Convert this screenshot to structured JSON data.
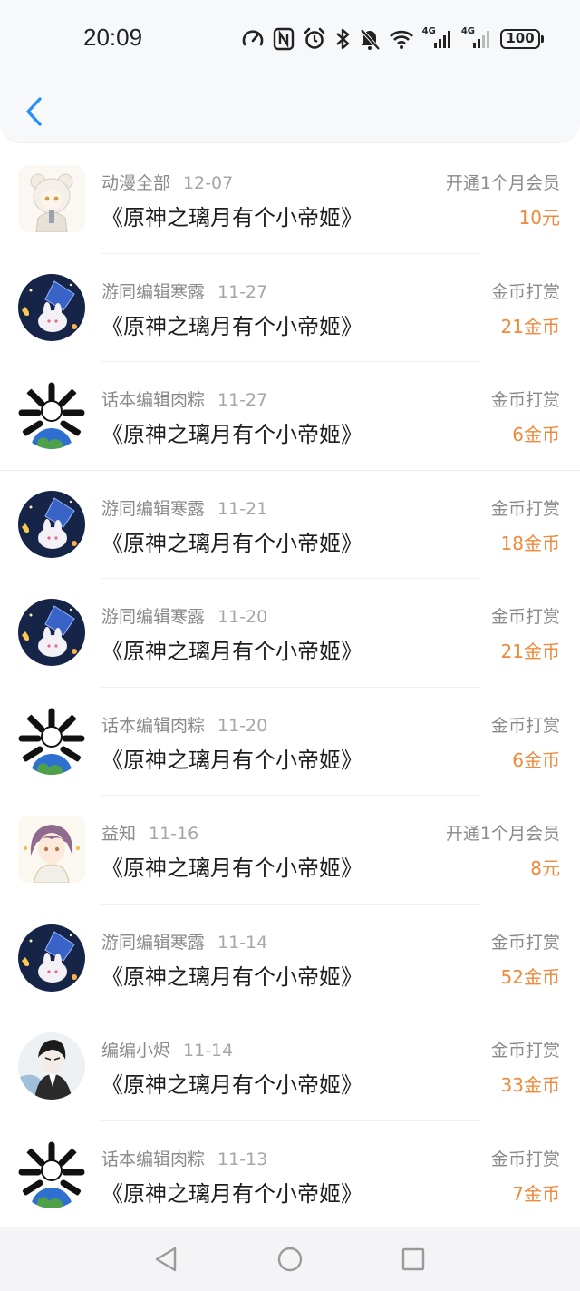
{
  "status_bar": {
    "time": "20:09",
    "net1": "4G",
    "net2": "4G",
    "battery": "100"
  },
  "colors": {
    "accent_blue": "#2a8ff7",
    "amount_orange": "#ef8a3c"
  },
  "records": [
    {
      "user": "动漫全部",
      "date": "12-07",
      "title": "《原神之璃月有个小帝姬》",
      "type": "开通1个月会员",
      "amount": "10元",
      "avatar": "anime-girl-white-hair"
    },
    {
      "user": "游同编辑寒露",
      "date": "11-27",
      "title": "《原神之璃月有个小帝姬》",
      "type": "金币打赏",
      "amount": "21金币",
      "avatar": "night-sky-bunny"
    },
    {
      "user": "话本编辑肉粽",
      "date": "11-27",
      "title": "《原神之璃月有个小帝姬》",
      "type": "金币打赏",
      "amount": "6金币",
      "avatar": "bones-globe"
    },
    {
      "user": "游同编辑寒露",
      "date": "11-21",
      "title": "《原神之璃月有个小帝姬》",
      "type": "金币打赏",
      "amount": "18金币",
      "avatar": "night-sky-bunny"
    },
    {
      "user": "游同编辑寒露",
      "date": "11-20",
      "title": "《原神之璃月有个小帝姬》",
      "type": "金币打赏",
      "amount": "21金币",
      "avatar": "night-sky-bunny"
    },
    {
      "user": "话本编辑肉粽",
      "date": "11-20",
      "title": "《原神之璃月有个小帝姬》",
      "type": "金币打赏",
      "amount": "6金币",
      "avatar": "bones-globe"
    },
    {
      "user": "益知",
      "date": "11-16",
      "title": "《原神之璃月有个小帝姬》",
      "type": "开通1个月会员",
      "amount": "8元",
      "avatar": "anime-boy-purple"
    },
    {
      "user": "游同编辑寒露",
      "date": "11-14",
      "title": "《原神之璃月有个小帝姬》",
      "type": "金币打赏",
      "amount": "52金币",
      "avatar": "night-sky-bunny"
    },
    {
      "user": "编编小烬",
      "date": "11-14",
      "title": "《原神之璃月有个小帝姬》",
      "type": "金币打赏",
      "amount": "33金币",
      "avatar": "ink-portrait"
    },
    {
      "user": "话本编辑肉粽",
      "date": "11-13",
      "title": "《原神之璃月有个小帝姬》",
      "type": "金币打赏",
      "amount": "7金币",
      "avatar": "bones-globe"
    }
  ]
}
